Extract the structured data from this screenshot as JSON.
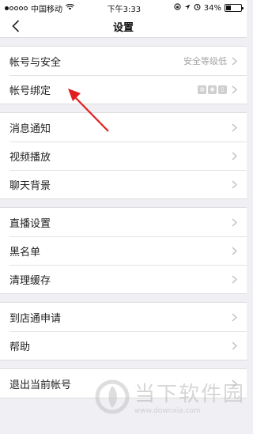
{
  "status": {
    "carrier": "中国移动",
    "time": "下午3:33",
    "battery_pct": "34%",
    "battery_level": 0.34
  },
  "nav": {
    "title": "设置",
    "back_icon": "chevron-left-icon"
  },
  "groups": [
    {
      "items": [
        {
          "label": "帐号与安全",
          "value": "安全等级低"
        },
        {
          "label": "帐号绑定",
          "value": ""
        }
      ]
    },
    {
      "items": [
        {
          "label": "消息通知"
        },
        {
          "label": "视频播放"
        },
        {
          "label": "聊天背景"
        }
      ]
    },
    {
      "items": [
        {
          "label": "直播设置"
        },
        {
          "label": "黑名单"
        },
        {
          "label": "清理缓存"
        }
      ]
    },
    {
      "items": [
        {
          "label": "到店通申请"
        },
        {
          "label": "帮助"
        }
      ]
    },
    {
      "items": [
        {
          "label": "退出当前帐号"
        }
      ]
    }
  ],
  "annotation_color": "#e02020",
  "watermark": {
    "text": "当下软件园",
    "url": "www.downxia.com"
  }
}
